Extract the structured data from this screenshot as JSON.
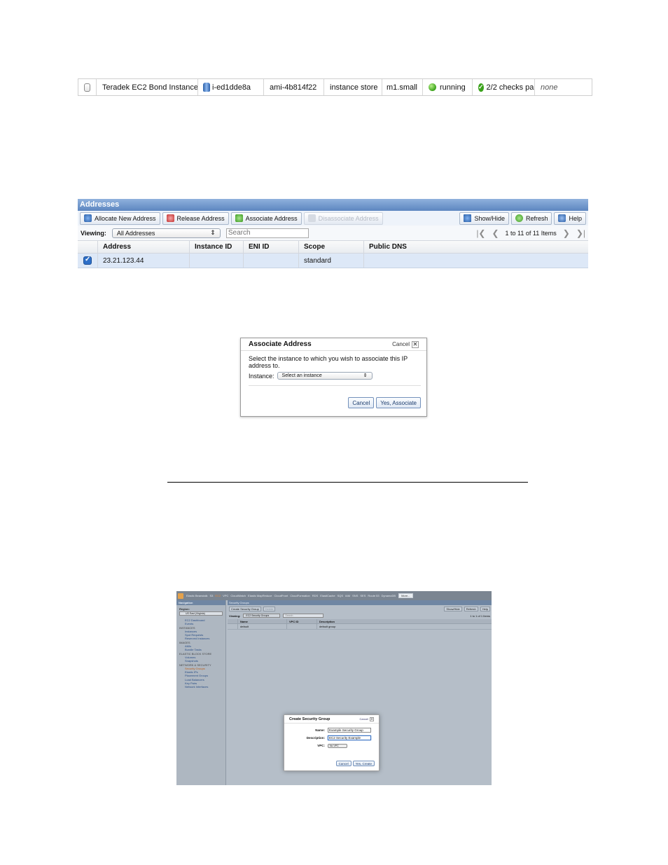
{
  "instance_row": {
    "name": "Teradek EC2 Bond Instance",
    "instance_id": "i-ed1dde8a",
    "ami": "ami-4b814f22",
    "root_device": "instance store",
    "type": "m1.small",
    "state": "running",
    "status_checks": "2/2 checks pa",
    "alarm": "none"
  },
  "addresses": {
    "title": "Addresses",
    "toolbar": {
      "allocate": "Allocate New Address",
      "release": "Release Address",
      "associate": "Associate Address",
      "disassociate": "Disassociate Address",
      "showhide": "Show/Hide",
      "refresh": "Refresh",
      "help": "Help"
    },
    "viewing_label": "Viewing:",
    "viewing_value": "All Addresses",
    "search_placeholder": "Search",
    "pager_text": "1 to 11 of 11 Items",
    "columns": [
      "Address",
      "Instance ID",
      "ENI ID",
      "Scope",
      "Public DNS"
    ],
    "rows": [
      {
        "address": "23.21.123.44",
        "instance_id": "",
        "eni_id": "",
        "scope": "standard",
        "public_dns": ""
      }
    ]
  },
  "associate_dialog": {
    "title": "Associate Address",
    "cancel_link": "Cancel",
    "message": "Select the instance to which you wish to associate this IP address to.",
    "instance_label": "Instance:",
    "instance_select": "Select an instance",
    "cancel_btn": "Cancel",
    "confirm_btn": "Yes, Associate"
  },
  "console": {
    "tabs": [
      "Elastic Beanstalk",
      "S3",
      "EC2",
      "VPC",
      "CloudWatch",
      "Elastic MapReduce",
      "CloudFront",
      "CloudFormation",
      "RDS",
      "ElastiCache",
      "SQS",
      "IAM",
      "SNS",
      "SES",
      "Route 53",
      "DynamoDB"
    ],
    "more": "More...",
    "nav_title": "Navigation",
    "region_label": "Region:",
    "region_value": "US East (Virginia)",
    "nav": [
      {
        "type": "item",
        "label": "EC2 Dashboard"
      },
      {
        "type": "item",
        "label": "Events"
      },
      {
        "type": "sec",
        "label": "INSTANCES"
      },
      {
        "type": "item",
        "label": "Instances"
      },
      {
        "type": "item",
        "label": "Spot Requests"
      },
      {
        "type": "item",
        "label": "Reserved Instances"
      },
      {
        "type": "sec",
        "label": "IMAGES"
      },
      {
        "type": "item",
        "label": "AMIs"
      },
      {
        "type": "item",
        "label": "Bundle Tasks"
      },
      {
        "type": "sec",
        "label": "ELASTIC BLOCK STORE"
      },
      {
        "type": "item",
        "label": "Volumes"
      },
      {
        "type": "item",
        "label": "Snapshots"
      },
      {
        "type": "sec",
        "label": "NETWORK & SECURITY"
      },
      {
        "type": "item active",
        "label": "Security Groups"
      },
      {
        "type": "item",
        "label": "Elastic IPs"
      },
      {
        "type": "item",
        "label": "Placement Groups"
      },
      {
        "type": "item",
        "label": "Load Balancers"
      },
      {
        "type": "item",
        "label": "Key Pairs"
      },
      {
        "type": "item",
        "label": "Network Interfaces"
      }
    ],
    "section_title": "Security Groups",
    "create_btn": "Create Security Group",
    "delete_btn": "Delete",
    "showhide": "Show/Hide",
    "refresh": "Refresh",
    "help": "Help",
    "viewing_label": "Viewing:",
    "viewing_value": "EC2 Security Groups",
    "search_placeholder": "Search",
    "pager_text": "1 to 1 of 1 Items",
    "columns": [
      "Name",
      "VPC ID",
      "Description"
    ],
    "rows": [
      {
        "name": "default",
        "vpc_id": "",
        "description": "default group"
      }
    ],
    "dialog": {
      "title": "Create Security Group",
      "cancel_link": "Cancel",
      "name_label": "Name:",
      "name_value": "Example Security Group",
      "desc_label": "Description:",
      "desc_value": "EC2 Security Example",
      "vpc_label": "VPC:",
      "vpc_value": "No VPC",
      "cancel_btn": "Cancel",
      "confirm_btn": "Yes, Create"
    }
  }
}
